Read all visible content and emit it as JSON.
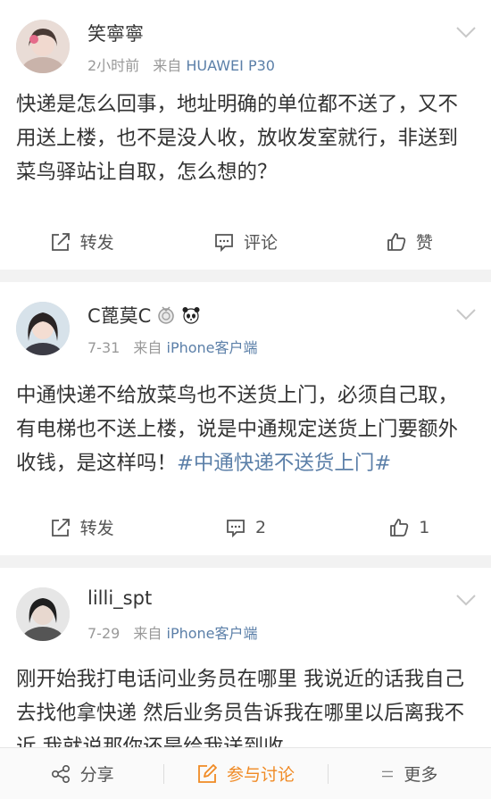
{
  "posts": [
    {
      "user": "笑寧寧",
      "time": "2小时前",
      "from_label": "来自",
      "source": "HUAWEI P30",
      "text": "快递是怎么回事，地址明确的单位都不送了，又不用送上楼，也不是没人收，放收发室就行，非送到菜鸟驿站让自取，怎么想的？",
      "repost_label": "转发",
      "comment_label": "评论",
      "like_label": "赞"
    },
    {
      "user": "C蓖莫C",
      "time": "7-31",
      "from_label": "来自",
      "source": "iPhone客户端",
      "text": "中通快递不给放菜鸟也不送货上门，必须自己取，有电梯也不送上楼，说是中通规定送货上门要额外收钱，是这样吗！",
      "hashtag": "#中通快递不送货上门#",
      "repost_label": "转发",
      "comment_label": "2",
      "like_label": "1"
    },
    {
      "user": "lilli_spt",
      "time": "7-29",
      "from_label": "来自",
      "source": "iPhone客户端",
      "text": "刚开始我打电话问业务员在哪里 我说近的话我自己去找他拿快递 然后业务员告诉我在哪里以后离我不近 我就说那你还是给我送到收"
    }
  ],
  "bottom_bar": {
    "share_label": "分享",
    "discuss_label": "参与讨论",
    "more_label": "更多"
  },
  "colors": {
    "link": "#5b7fa8",
    "accent": "#f08a24",
    "meta": "#999999"
  },
  "icons": [
    "avatar",
    "chevron-down-icon",
    "repost-icon",
    "comment-icon",
    "like-icon",
    "medal-icon",
    "panda-icon",
    "share-icon",
    "edit-icon",
    "menu-icon"
  ]
}
